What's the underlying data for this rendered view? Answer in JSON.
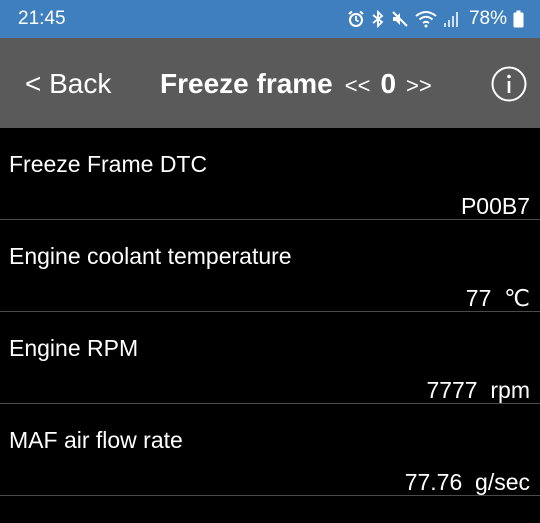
{
  "status_bar": {
    "time": "21:45",
    "battery": "78%",
    "icons": [
      "alarm-icon",
      "bluetooth-icon",
      "mute-icon",
      "wifi-icon",
      "signal-icon",
      "battery-icon"
    ]
  },
  "toolbar": {
    "back_label": "< Back",
    "title": "Freeze frame",
    "prev_label": "<<",
    "frame_index": "0",
    "next_label": ">>",
    "info_icon": "info-icon"
  },
  "rows": [
    {
      "label": "Freeze Frame DTC",
      "value": "P00B7"
    },
    {
      "label": "Engine coolant temperature",
      "value": "77  ℃"
    },
    {
      "label": "Engine RPM",
      "value": "7777  rpm"
    },
    {
      "label": "MAF air flow rate",
      "value": "77.76  g/sec"
    }
  ],
  "colors": {
    "status_bar_bg": "#3f7fbd",
    "toolbar_bg": "#5a5a5a",
    "background": "#000000",
    "divider": "#4a4a4a",
    "text": "#ffffff"
  }
}
